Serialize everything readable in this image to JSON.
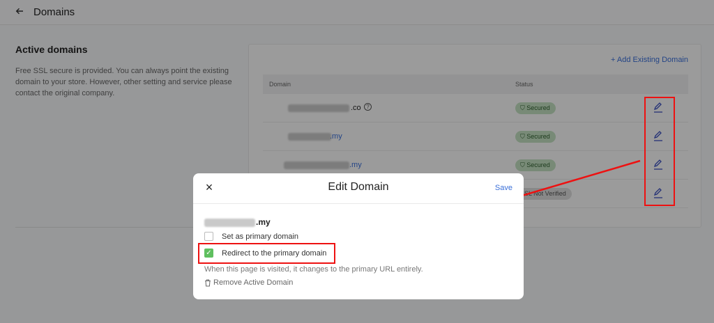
{
  "header": {
    "title": "Domains"
  },
  "section": {
    "title": "Active domains",
    "description": "Free SSL secure is provided. You can always point the existing domain to your store. However, other setting and service please contact the original company."
  },
  "card": {
    "add_link": "+ Add Existing Domain",
    "columns": {
      "domain": "Domain",
      "status": "Status"
    },
    "rows": [
      {
        "domain_suffix": ".co",
        "status": "Secured"
      },
      {
        "domain_suffix": ".my",
        "status": "Secured"
      },
      {
        "domain_suffix": ".my",
        "status": "Secured"
      },
      {
        "status": "SSL Not Verified"
      }
    ]
  },
  "modal": {
    "title": "Edit Domain",
    "save_label": "Save",
    "domain_suffix": ".my",
    "set_primary_label": "Set as primary domain",
    "set_primary_checked": false,
    "redirect_label": "Redirect to the primary domain",
    "redirect_checked": true,
    "hint": "When this page is visited, it changes to the primary URL entirely.",
    "remove_label": "Remove Active Domain"
  },
  "colors": {
    "accent": "#3a6fd8",
    "annotation": "#ee1111",
    "secured_badge": "#c2dfc0",
    "check_green": "#5fbf5f"
  }
}
